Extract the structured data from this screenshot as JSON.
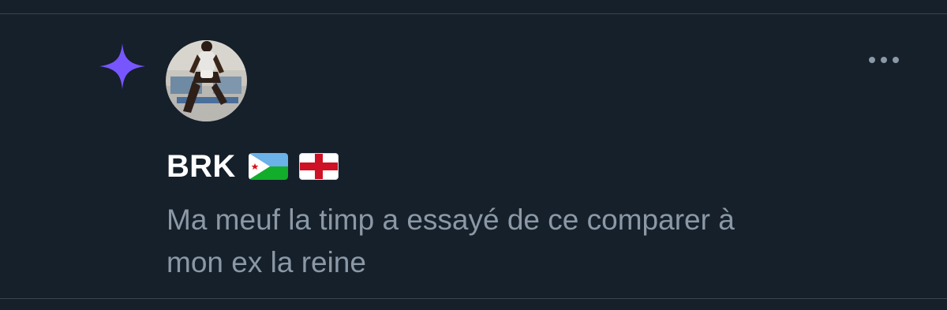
{
  "post": {
    "author": {
      "display_name": "BRK",
      "flags": [
        "djibouti-flag-icon",
        "england-flag-icon"
      ]
    },
    "lines": [
      "Ma meuf la timp a essayé de ce comparer à",
      "mon ex la reine"
    ],
    "badge_icon": "sparkle-icon",
    "menu_icon": "more-options-icon"
  },
  "colors": {
    "background": "#15202b",
    "divider": "#38444d",
    "sparkle": "#7856ff",
    "name": "#ffffff",
    "text": "#8b98a5",
    "menu": "#8b98a5"
  }
}
